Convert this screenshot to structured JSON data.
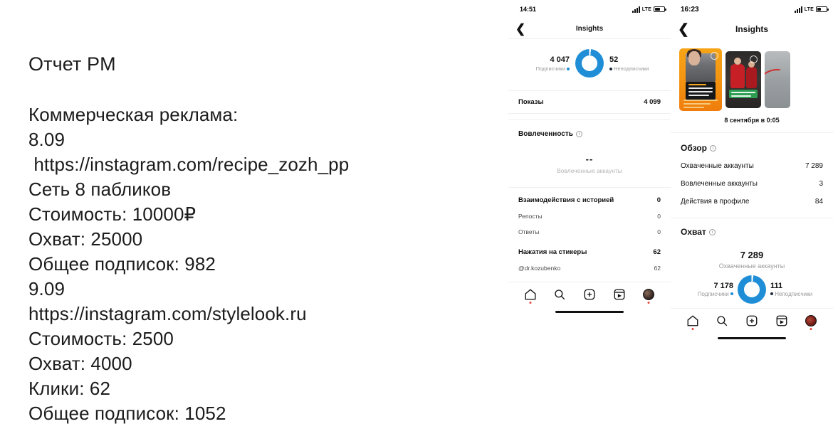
{
  "report": {
    "title": "Отчет PM",
    "lines": [
      "Коммерческая реклама:",
      "8.09",
      " https://instagram.com/recipe_zozh_pp",
      "Сеть 8 пабликов",
      "Стоимость: 10000₽",
      "Охват: 25000",
      "Общее подписок: 982",
      "9.09",
      "https://instagram.com/stylelook.ru",
      "Стоимость: 2500",
      "Охват: 4000",
      "Клики: 62",
      "Общее подписок: 1052"
    ]
  },
  "phone_left": {
    "status": {
      "time": "14:51",
      "network": "LTE"
    },
    "nav": {
      "back_icon": "chevron-left-icon",
      "title": "Insights"
    },
    "top_stats": {
      "followers_value": "4 047",
      "followers_label": "Подписчики",
      "nonfollowers_value": "52",
      "nonfollowers_label": "Неподписчики"
    },
    "impressions": {
      "label": "Показы",
      "value": "4 099"
    },
    "engagement": {
      "title": "Вовлеченность",
      "big_value": "--",
      "sub_label": "Вовлеченные аккаунты"
    },
    "story_interactions": {
      "label": "Взаимодействия с историей",
      "value": "0",
      "rows": [
        {
          "label": "Репосты",
          "value": "0"
        },
        {
          "label": "Ответы",
          "value": "0"
        }
      ]
    },
    "sticker_taps": {
      "label": "Нажатия на стикеры",
      "value": "62",
      "rows": [
        {
          "label": "@dr.kozubenko",
          "value": "62"
        }
      ]
    },
    "tabbar": [
      {
        "name": "home-icon"
      },
      {
        "name": "search-icon"
      },
      {
        "name": "add-post-icon"
      },
      {
        "name": "reels-icon"
      },
      {
        "name": "profile-avatar-icon"
      }
    ]
  },
  "phone_right": {
    "status": {
      "time": "16:23",
      "network": "LTE"
    },
    "nav": {
      "back_icon": "chevron-left-icon",
      "title": "Insights"
    },
    "story_date": "8 сентября в 0:05",
    "overview": {
      "title": "Обзор",
      "rows": [
        {
          "label": "Охваченные аккаунты",
          "value": "7 289"
        },
        {
          "label": "Вовлеченные аккаунты",
          "value": "3"
        },
        {
          "label": "Действия в профиле",
          "value": "84"
        }
      ]
    },
    "reach": {
      "title": "Охват",
      "big_value": "7 289",
      "big_label": "Охваченные аккаунты",
      "followers_value": "7 178",
      "followers_label": "Подписчики",
      "nonfollowers_value": "111",
      "nonfollowers_label": "Неподписчики"
    },
    "tabbar": [
      {
        "name": "home-icon"
      },
      {
        "name": "search-icon"
      },
      {
        "name": "add-post-icon"
      },
      {
        "name": "reels-icon"
      },
      {
        "name": "profile-avatar-icon"
      }
    ]
  },
  "colors": {
    "accent": "#1f8ed6",
    "text": "#111111",
    "muted": "#9a9a9a"
  }
}
